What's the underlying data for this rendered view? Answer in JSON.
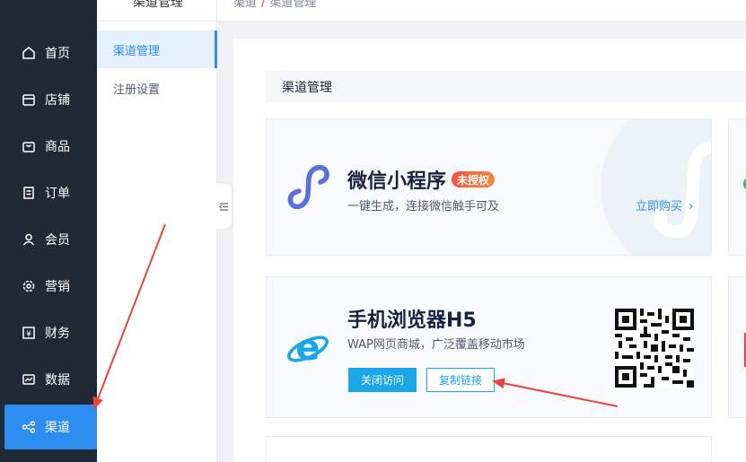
{
  "nav": {
    "items": [
      {
        "label": "首页",
        "icon": "home-icon"
      },
      {
        "label": "店铺",
        "icon": "store-icon"
      },
      {
        "label": "商品",
        "icon": "bag-icon"
      },
      {
        "label": "订单",
        "icon": "order-icon"
      },
      {
        "label": "会员",
        "icon": "user-icon"
      },
      {
        "label": "营销",
        "icon": "gear-icon"
      },
      {
        "label": "财务",
        "icon": "yen-icon"
      },
      {
        "label": "数据",
        "icon": "chart-icon"
      },
      {
        "label": "渠道",
        "icon": "share-icon"
      }
    ]
  },
  "subnav": {
    "title": "渠道管理",
    "items": [
      {
        "label": "渠道管理"
      },
      {
        "label": "注册设置"
      }
    ]
  },
  "breadcrumb": {
    "first": "渠道",
    "second": "渠道管理"
  },
  "section": {
    "title": "渠道管理"
  },
  "cards": {
    "wechat": {
      "title": "微信小程序",
      "badge": "未授权",
      "desc": "一键生成，连接微信触手可及",
      "buy": "立即购买"
    },
    "h5": {
      "title": "手机浏览器H5",
      "desc": "WAP网页商城，广泛覆盖移动市场",
      "close_btn": "关闭访问",
      "copy_btn": "复制链接"
    }
  },
  "colors": {
    "accent": "#2d8cf0",
    "nav_bg": "#1f2a36",
    "annotation_red": "#e8453c"
  }
}
